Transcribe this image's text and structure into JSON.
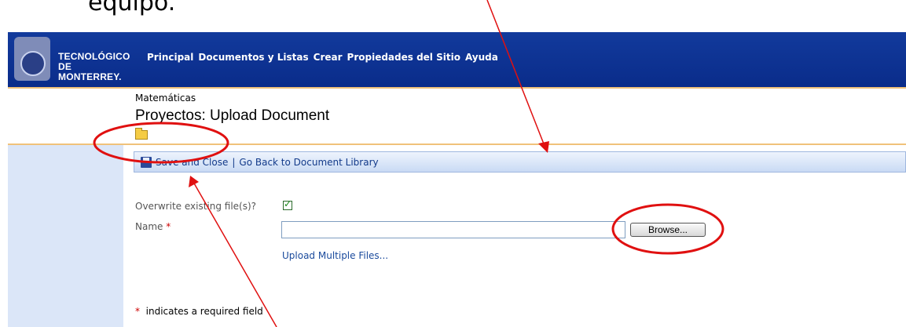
{
  "caption": "equipo.",
  "header": {
    "logo_line1": "TECNOLÓGICO",
    "logo_line2": "DE MONTERREY.",
    "nav": [
      "Principal",
      "Documentos y Listas",
      "Crear",
      "Propiedades del Sitio",
      "Ayuda"
    ]
  },
  "page": {
    "breadcrumb": "Matemáticas",
    "title": "Proyectos: Upload Document"
  },
  "toolbar": {
    "save_label": "Save and Close",
    "separator": "|",
    "back_label": "Go Back to Document Library"
  },
  "form": {
    "overwrite_label": "Overwrite existing file(s)?",
    "overwrite_checked": true,
    "name_label": "Name",
    "required_mark": "*",
    "name_value": "",
    "browse_label": "Browse...",
    "upload_multiple_label": "Upload Multiple Files...",
    "required_note": "indicates a required field"
  },
  "colors": {
    "header_blue": "#0a2c8a",
    "accent_orange": "#f0c27a",
    "panel_blue": "#dbe6f8",
    "annotation_red": "#e01010"
  }
}
